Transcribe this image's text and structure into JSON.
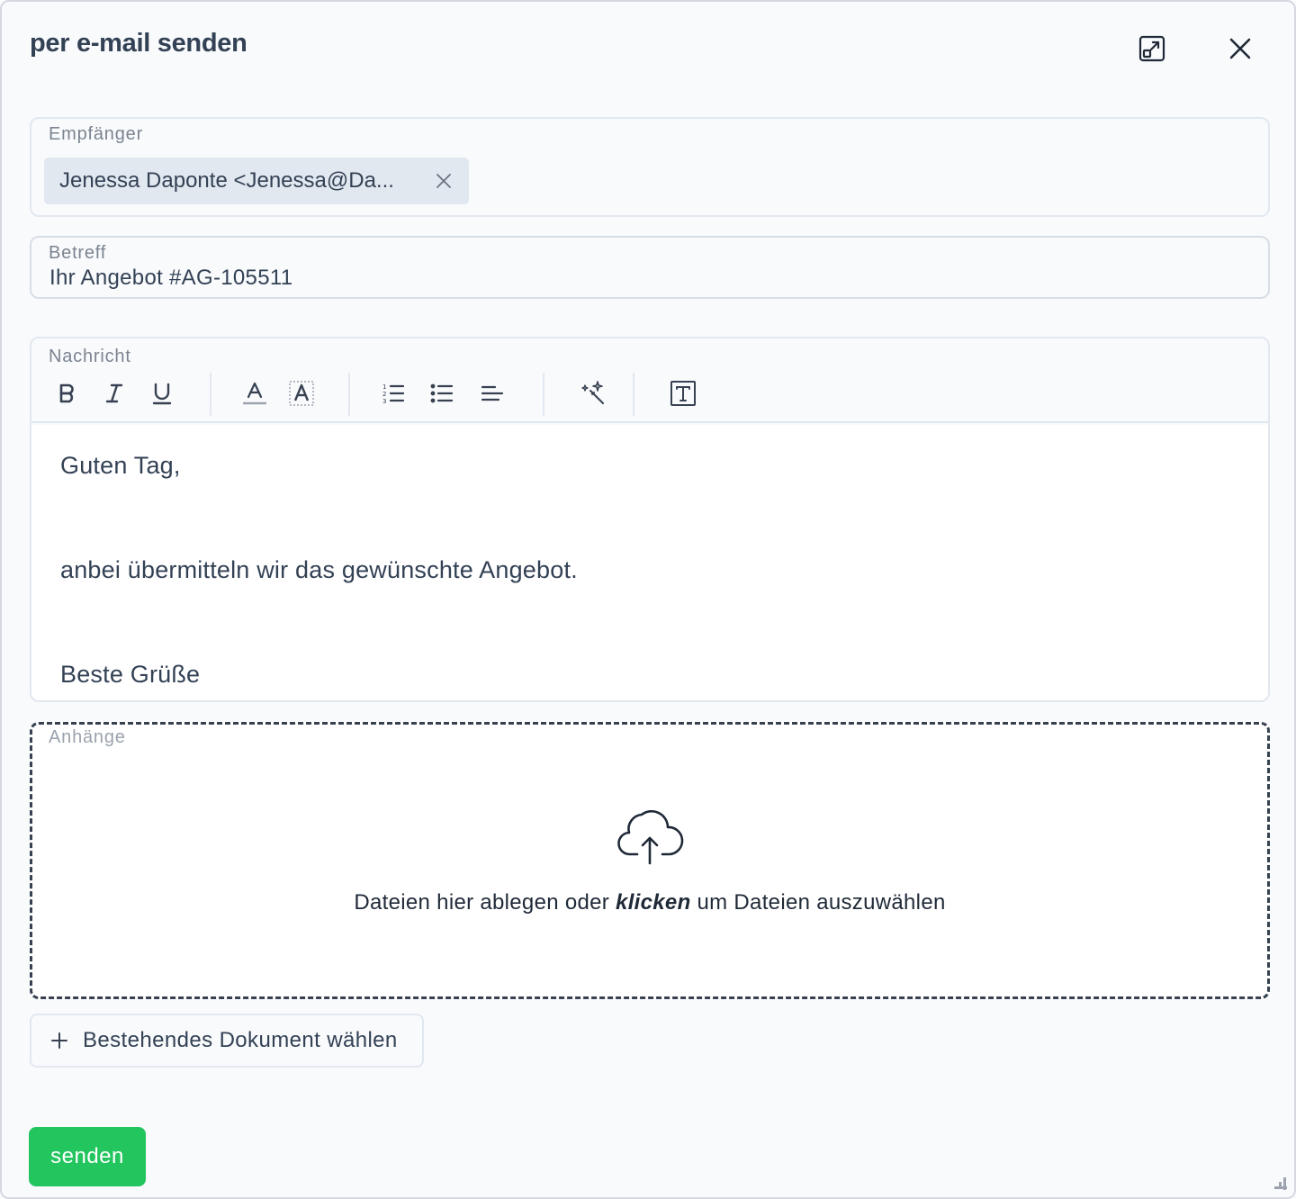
{
  "dialog": {
    "title": "per e-mail senden",
    "icons": {
      "expand": "expand-icon",
      "close": "close-icon"
    }
  },
  "recipients": {
    "label": "Empfänger",
    "chips": [
      {
        "text": "Jenessa Daponte <Jenessa@Da..."
      }
    ]
  },
  "subject": {
    "label": "Betreff",
    "value": "Ihr Angebot #AG-105511"
  },
  "message": {
    "label": "Nachricht",
    "toolbar": [
      "bold-icon",
      "italic-icon",
      "underline-icon",
      "text-color-icon",
      "highlight-icon",
      "ordered-list-icon",
      "bullet-list-icon",
      "align-left-icon",
      "magic-wand-icon",
      "text-box-icon"
    ],
    "lines": {
      "greeting": "Guten Tag,",
      "body": "anbei übermitteln wir das gewünschte Angebot.",
      "closing": "Beste Grüße"
    }
  },
  "attachments": {
    "label": "Anhänge",
    "drop_before": "Dateien hier ablegen oder ",
    "drop_emph": "klicken",
    "drop_after": " um Dateien auszuwählen",
    "choose_existing": "Bestehendes Dokument wählen"
  },
  "actions": {
    "send": "senden"
  },
  "colors": {
    "send_button": "#22c55e",
    "text": "#334155",
    "border": "#e2e8f0",
    "background": "#f8fafc"
  }
}
